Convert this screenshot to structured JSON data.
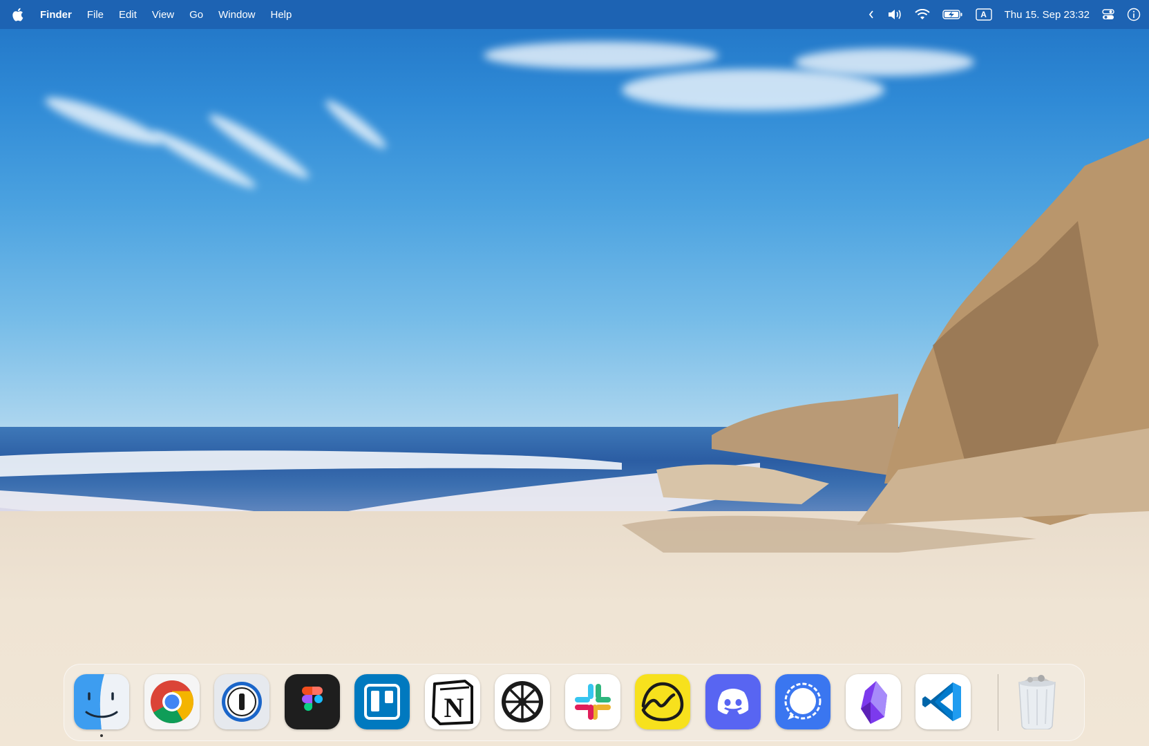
{
  "menubar": {
    "apple_icon": "apple-logo-icon",
    "app_name": "Finder",
    "menus": [
      "File",
      "Edit",
      "View",
      "Go",
      "Window",
      "Help"
    ],
    "status_icons": [
      "chevron-left-icon",
      "volume-icon",
      "wifi-icon",
      "battery-charging-icon",
      "input-source-icon",
      "control-center-icon",
      "info-icon"
    ],
    "input_source_letter": "A",
    "clock": "Thu 15. Sep  23:32"
  },
  "desktop": {
    "wallpaper": "beach-cliffs-wallpaper"
  },
  "dock": {
    "apps": [
      {
        "name": "Finder",
        "icon": "finder-icon",
        "running": true
      },
      {
        "name": "Google Chrome",
        "icon": "chrome-icon",
        "running": false
      },
      {
        "name": "1Password",
        "icon": "1password-icon",
        "running": false
      },
      {
        "name": "Figma",
        "icon": "figma-icon",
        "running": false
      },
      {
        "name": "Trello",
        "icon": "trello-icon",
        "running": false
      },
      {
        "name": "Notion",
        "icon": "notion-icon",
        "running": false
      },
      {
        "name": "Roam Research",
        "icon": "roam-icon",
        "running": false
      },
      {
        "name": "Slack",
        "icon": "slack-icon",
        "running": false
      },
      {
        "name": "Basecamp",
        "icon": "basecamp-icon",
        "running": false
      },
      {
        "name": "Discord",
        "icon": "discord-icon",
        "running": false
      },
      {
        "name": "Signal",
        "icon": "signal-icon",
        "running": false
      },
      {
        "name": "Obsidian",
        "icon": "obsidian-icon",
        "running": false
      },
      {
        "name": "Visual Studio Code",
        "icon": "vscode-icon",
        "running": false
      }
    ],
    "trash": {
      "name": "Trash",
      "icon": "trash-icon"
    },
    "notion_letter": "N"
  },
  "colors": {
    "menubar_bg": "#1d63b3",
    "dock_bg": "#f3ece2",
    "trello_blue": "#0079bf",
    "discord_blurple": "#5865f2",
    "signal_blue": "#3a76f0",
    "basecamp_yellow": "#f7e11d",
    "vscode_blue": "#0065a9"
  }
}
